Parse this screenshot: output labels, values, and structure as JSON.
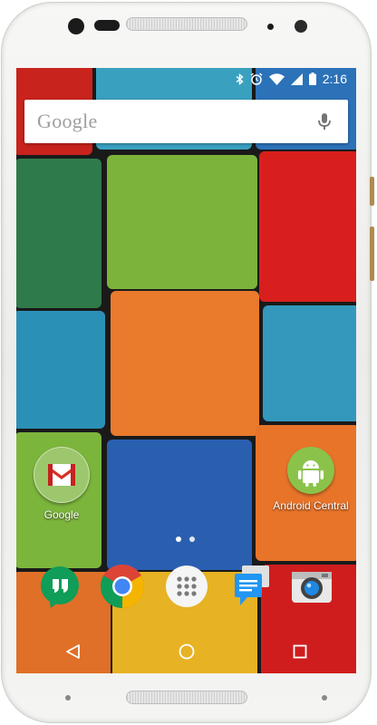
{
  "status_bar": {
    "icons": [
      "bluetooth-icon",
      "alarm-icon",
      "wifi-icon",
      "cellular-icon",
      "battery-icon"
    ],
    "time": "2:16"
  },
  "search_widget": {
    "logo_text": "Google",
    "mic_icon": "microphone-icon"
  },
  "home_apps": [
    {
      "label": "Google",
      "icon": "gmail-folder-icon"
    },
    {
      "label": "Android Central",
      "icon": "android-icon"
    }
  ],
  "page_indicator": {
    "pages": 2,
    "current": 1
  },
  "dock": [
    {
      "icon": "hangouts-icon"
    },
    {
      "icon": "chrome-icon"
    },
    {
      "icon": "app-drawer-icon"
    },
    {
      "icon": "messaging-icon"
    },
    {
      "icon": "camera-icon"
    }
  ],
  "nav_bar": [
    "back-icon",
    "home-icon",
    "recents-icon"
  ],
  "colors": {
    "gmail_red": "#d93025",
    "android_green": "#8bc34a",
    "hangouts_green": "#0f9d58",
    "chrome_red": "#db4437",
    "chrome_yellow": "#f4b400",
    "chrome_green": "#0f9d58",
    "chrome_blue": "#4285f4"
  }
}
